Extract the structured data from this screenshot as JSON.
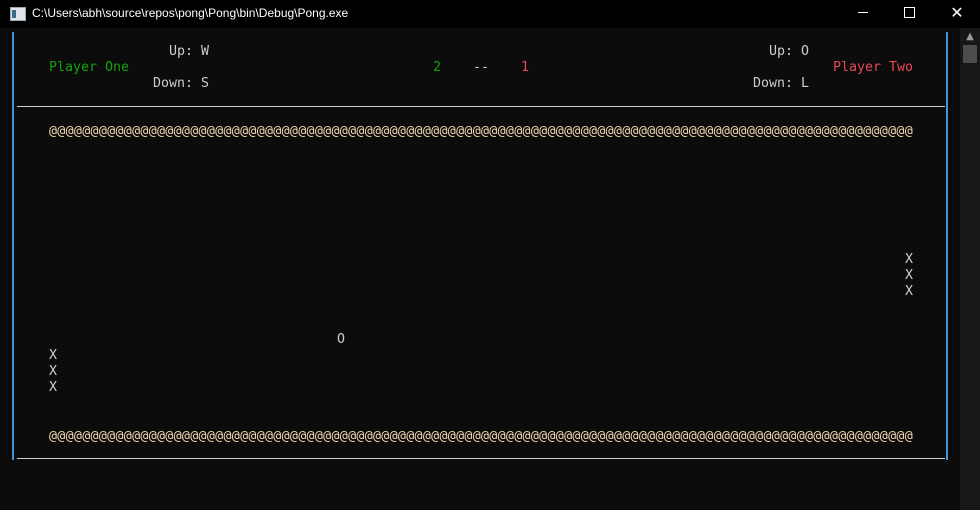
{
  "window": {
    "title": "C:\\Users\\abh\\source\\repos\\pong\\Pong\\bin\\Debug\\Pong.exe",
    "close_glyph": "✕",
    "scroll_up_glyph": "▲"
  },
  "header": {
    "player_one": {
      "name": "Player One",
      "up": "Up: W",
      "down": "Down: S",
      "color": "#13a10e"
    },
    "player_two": {
      "name": "Player Two",
      "up": "Up: O",
      "down": "Down: L",
      "color": "#e74856"
    },
    "score": {
      "player_one": "2",
      "separator": "--",
      "player_two": "1"
    }
  },
  "field": {
    "top_wall": "@@@@@@@@@@@@@@@@@@@@@@@@@@@@@@@@@@@@@@@@@@@@@@@@@@@@@@@@@@@@@@@@@@@@@@@@@@@@@@@@@@@@@@@@@@@@@@@@@@@@@@@@",
    "bottom_wall": "@@@@@@@@@@@@@@@@@@@@@@@@@@@@@@@@@@@@@@@@@@@@@@@@@@@@@@@@@@@@@@@@@@@@@@@@@@@@@@@@@@@@@@@@@@@@@@@@@@@@@@@@",
    "paddle_left": [
      "X",
      "X",
      "X"
    ],
    "paddle_right": [
      "X",
      "X",
      "X"
    ],
    "ball": "O"
  }
}
